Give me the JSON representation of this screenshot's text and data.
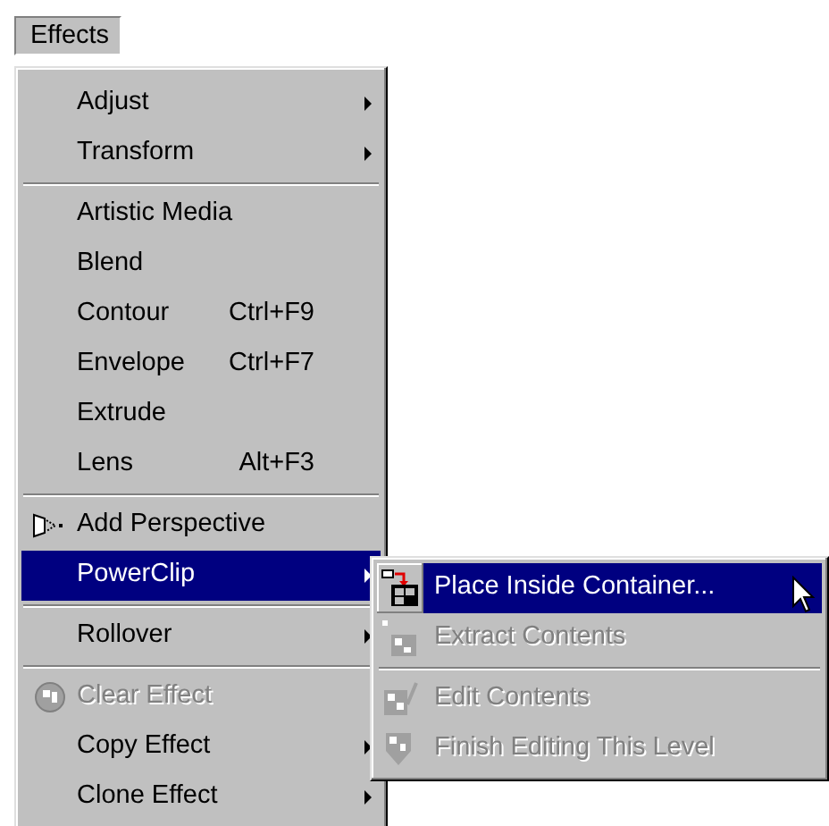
{
  "menu_bar": [
    {
      "label": "Effects",
      "selected": true
    }
  ],
  "menu": {
    "items": [
      {
        "kind": "item",
        "label": "Adjust",
        "submenu": true,
        "disabled": false,
        "selected": false
      },
      {
        "kind": "item",
        "label": "Transform",
        "submenu": true,
        "disabled": false,
        "selected": false
      },
      {
        "kind": "separator"
      },
      {
        "kind": "item",
        "label": "Artistic Media",
        "submenu": false,
        "disabled": false,
        "selected": false
      },
      {
        "kind": "item",
        "label": "Blend",
        "submenu": false,
        "disabled": false,
        "selected": false
      },
      {
        "kind": "item",
        "label": "Contour",
        "shortcut": "Ctrl+F9",
        "submenu": false,
        "disabled": false,
        "selected": false
      },
      {
        "kind": "item",
        "label": "Envelope",
        "shortcut": "Ctrl+F7",
        "submenu": false,
        "disabled": false,
        "selected": false
      },
      {
        "kind": "item",
        "label": "Extrude",
        "submenu": false,
        "disabled": false,
        "selected": false
      },
      {
        "kind": "item",
        "label": "Lens",
        "shortcut": "Alt+F3",
        "submenu": false,
        "disabled": false,
        "selected": false
      },
      {
        "kind": "separator"
      },
      {
        "kind": "item",
        "label": "Add Perspective",
        "submenu": false,
        "disabled": false,
        "selected": false
      },
      {
        "kind": "item",
        "label": "PowerClip",
        "submenu": true,
        "disabled": false,
        "selected": true
      },
      {
        "kind": "separator"
      },
      {
        "kind": "item",
        "label": "Rollover",
        "submenu": true,
        "disabled": false,
        "selected": false
      },
      {
        "kind": "separator"
      },
      {
        "kind": "item",
        "label": "Clear Effect",
        "submenu": false,
        "disabled": true,
        "selected": false
      },
      {
        "kind": "item",
        "label": "Copy Effect",
        "submenu": true,
        "disabled": false,
        "selected": false
      },
      {
        "kind": "item",
        "label": "Clone Effect",
        "submenu": true,
        "disabled": false,
        "selected": false
      }
    ]
  },
  "submenu": {
    "items": [
      {
        "kind": "item",
        "label": "Place Inside Container...",
        "disabled": false,
        "selected": true
      },
      {
        "kind": "item",
        "label": "Extract Contents",
        "disabled": true,
        "selected": false
      },
      {
        "kind": "separator"
      },
      {
        "kind": "item",
        "label": "Edit Contents",
        "disabled": true,
        "selected": false
      },
      {
        "kind": "item",
        "label": "Finish Editing This Level",
        "disabled": true,
        "selected": false
      }
    ]
  }
}
